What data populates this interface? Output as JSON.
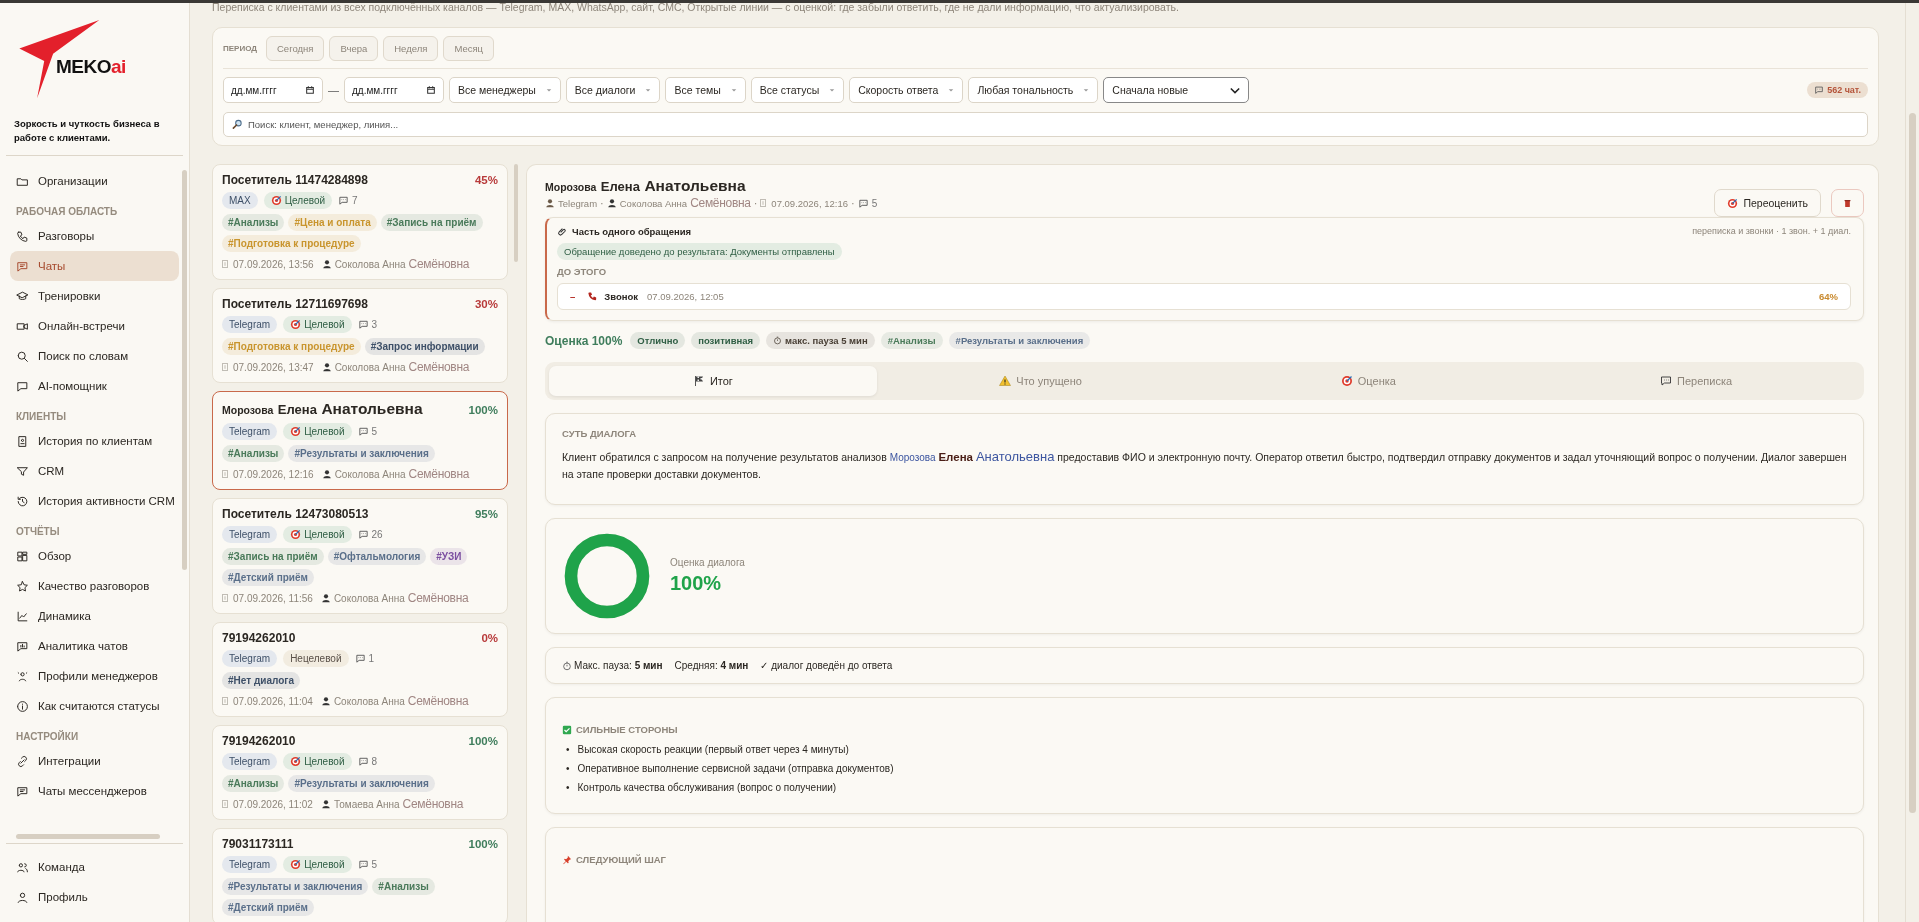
{
  "page": {
    "subtitle": "Переписка с клиентами из всех подключённых каналов — Telegram, MAX, WhatsApp, сайт, СМС, Открытые линии — с оценкой: где забыли ответить, где не дали информацию, что актуализировать."
  },
  "sidebar": {
    "logo": {
      "main": "MEKO",
      "accent": "ai"
    },
    "tagline": "Зоркость и чуткость бизнеса в работе с клиентами.",
    "groups": [
      {
        "items": [
          {
            "label": "Организации",
            "kind": "folder",
            "selected": false
          }
        ]
      },
      {
        "title": "РАБОЧАЯ ОБЛАСТЬ",
        "items": [
          {
            "label": "Разговоры",
            "kind": "phone",
            "selected": false
          },
          {
            "label": "Чаты",
            "kind": "chat",
            "selected": true
          },
          {
            "label": "Тренировки",
            "kind": "cap",
            "selected": false
          },
          {
            "label": "Онлайн-встречи",
            "kind": "video",
            "selected": false
          },
          {
            "label": "Поиск по словам",
            "kind": "search",
            "selected": false
          },
          {
            "label": "AI-помощник",
            "kind": "bubble",
            "selected": false
          }
        ]
      },
      {
        "title": "КЛИЕНТЫ",
        "items": [
          {
            "label": "История по клиентам",
            "kind": "card",
            "selected": false
          },
          {
            "label": "CRM",
            "kind": "filter",
            "selected": false
          },
          {
            "label": "История активности CRM",
            "kind": "history",
            "selected": false
          }
        ]
      },
      {
        "title": "ОТЧЁТЫ",
        "items": [
          {
            "label": "Обзор",
            "kind": "grid",
            "selected": false
          },
          {
            "label": "Качество разговоров",
            "kind": "star",
            "selected": false
          },
          {
            "label": "Динамика",
            "kind": "chart",
            "selected": false
          },
          {
            "label": "Аналитика чатов",
            "kind": "stats",
            "selected": false
          },
          {
            "label": "Профили менеджеров",
            "kind": "profile",
            "selected": false
          },
          {
            "label": "Как считаются статусы",
            "kind": "info",
            "selected": false
          }
        ]
      },
      {
        "title": "НАСТРОЙКИ",
        "items": [
          {
            "label": "Интеграции",
            "kind": "link",
            "selected": false
          },
          {
            "label": "Чаты мессенджеров",
            "kind": "chat",
            "selected": false
          }
        ]
      }
    ],
    "footer": [
      {
        "label": "Команда",
        "kind": "team",
        "selected": false
      },
      {
        "label": "Профиль",
        "kind": "user",
        "selected": false
      }
    ]
  },
  "filters": {
    "period_label": "ПЕРИОД",
    "periods": [
      {
        "label": "Сегодня",
        "selected": false
      },
      {
        "label": "Вчера",
        "selected": false
      },
      {
        "label": "Неделя",
        "selected": false
      },
      {
        "label": "Месяц",
        "selected": false
      }
    ],
    "date_from": {
      "placeholder": "дд.мм.гггг"
    },
    "date_separator": "—",
    "date_to": {
      "placeholder": "дд.мм.гггг"
    },
    "dropdowns": [
      "Все менеджеры",
      "Все диалоги",
      "Все темы",
      "Все статусы",
      "Скорость ответа",
      "Любая тональность"
    ],
    "sort": "Сначала новые",
    "count": "562 чат.",
    "search": {
      "placeholder": "Поиск: клиент, менеджер, линия..."
    }
  },
  "chats": [
    {
      "title": "Посетитель 11474284898",
      "score": "45%",
      "color": "#b83a3a",
      "channel": "MAX",
      "target": {
        "label": "Целевой",
        "targeted": true
      },
      "messages": "7",
      "tags": [
        {
          "label": "#Анализы",
          "color": "#4a7a5a"
        },
        {
          "label": "#Цена и оплата",
          "color": "#c9952e"
        },
        {
          "label": "#Запись на приём",
          "color": "#4a7a5a"
        },
        {
          "label": "#Подготовка к процедуре",
          "color": "#c9952e"
        }
      ],
      "date": "07.09.2026, 13:56",
      "manager": [
        "Соколова Анна",
        "Семёновна"
      ],
      "selected": false
    },
    {
      "title": "Посетитель 12711697698",
      "score": "30%",
      "color": "#b83a3a",
      "channel": "Telegram",
      "target": {
        "label": "Целевой",
        "targeted": true
      },
      "messages": "3",
      "tags": [
        {
          "label": "#Подготовка к процедуре",
          "color": "#c9952e"
        },
        {
          "label": "#Запрос информации",
          "color": "#3e5068"
        }
      ],
      "date": "07.09.2026, 13:47",
      "manager": [
        "Соколова Анна",
        "Семёновна"
      ],
      "selected": false
    },
    {
      "name": [
        "Морозова",
        "Елена",
        "Анатольевна"
      ],
      "score": "100%",
      "color": "#3f7d5c",
      "channel": "Telegram",
      "target": {
        "label": "Целевой",
        "targeted": true
      },
      "messages": "5",
      "tags": [
        {
          "label": "#Анализы",
          "color": "#4a7a5a"
        },
        {
          "label": "#Результаты и заключения",
          "color": "#5a6f8a"
        }
      ],
      "date": "07.09.2026, 12:16",
      "manager": [
        "Соколова Анна",
        "Семёновна"
      ],
      "selected": true
    },
    {
      "title": "Посетитель 12473080513",
      "score": "95%",
      "color": "#3f7d5c",
      "channel": "Telegram",
      "target": {
        "label": "Целевой",
        "targeted": true
      },
      "messages": "26",
      "tags": [
        {
          "label": "#Запись на приём",
          "color": "#4a7a5a"
        },
        {
          "label": "#Офтальмология",
          "color": "#5a6f8a"
        },
        {
          "label": "#УЗИ",
          "color": "#7b4fa0"
        },
        {
          "label": "#Детский приём",
          "color": "#5a6f8a"
        }
      ],
      "date": "07.09.2026, 11:56",
      "manager": [
        "Соколова Анна",
        "Семёновна"
      ],
      "selected": false
    },
    {
      "title": "79194262010",
      "score": "0%",
      "color": "#b83a3a",
      "channel": "Telegram",
      "target": {
        "label": "Нецелевой",
        "targeted": false
      },
      "messages": "1",
      "tags": [
        {
          "label": "#Нет диалога",
          "color": "#3e5068"
        }
      ],
      "date": "07.09.2026, 11:04",
      "manager": [
        "Соколова Анна",
        "Семёновна"
      ],
      "selected": false
    },
    {
      "title": "79194262010",
      "score": "100%",
      "color": "#3f7d5c",
      "channel": "Telegram",
      "target": {
        "label": "Целевой",
        "targeted": true
      },
      "messages": "8",
      "tags": [
        {
          "label": "#Анализы",
          "color": "#4a7a5a"
        },
        {
          "label": "#Результаты и заключения",
          "color": "#5a6f8a"
        }
      ],
      "date": "07.09.2026, 11:02",
      "manager": [
        "Томаева Анна",
        "Семёновна"
      ],
      "selected": false
    },
    {
      "title": "79031173111",
      "score": "100%",
      "color": "#3f7d5c",
      "channel": "Telegram",
      "target": {
        "label": "Целевой",
        "targeted": true
      },
      "messages": "5",
      "tags": [
        {
          "label": "#Результаты и заключения",
          "color": "#5a6f8a"
        },
        {
          "label": "#Анализы",
          "color": "#4a7a5a"
        },
        {
          "label": "#Детский приём",
          "color": "#5a6f8a"
        }
      ],
      "selected": false
    }
  ],
  "detail": {
    "name": [
      "Морозова",
      "Елена",
      "Анатольевна"
    ],
    "meta": {
      "separator": "·",
      "channel": "Telegram",
      "manager": [
        "Соколова Анна",
        "Семёновна"
      ],
      "date": "07.09.2026, 12:16",
      "messages": "5"
    },
    "rescore": "Переоценить",
    "linked": {
      "title": "Часть одного обращения",
      "summary": "переписка и звонки · 1 звон. + 1 диал.",
      "result": "Обращение доведено до результата: Документы отправлены",
      "before_label": "ДО ЭТОГО",
      "events": [
        {
          "toggle": "–",
          "kind": "call",
          "label": "Звонок",
          "date": "07.09.2026, 12:05",
          "score": "64%"
        }
      ]
    },
    "score": {
      "label": "Оценка 100%",
      "tags": [
        {
          "label": "Отлично",
          "kind": "plain",
          "color": "#2f5e44"
        },
        {
          "label": "позитивная",
          "kind": "plain",
          "color": "#2f5e44"
        },
        {
          "label": "макс. пауза 5 мин",
          "kind": "timer",
          "color": "#4a4036"
        },
        {
          "label": "#Анализы",
          "kind": "plain",
          "color": "#4a7a5a"
        },
        {
          "label": "#Результаты и заключения",
          "kind": "plain",
          "color": "#5a6f8a"
        }
      ]
    },
    "tabs": [
      {
        "label": "Итог",
        "kind": "flag",
        "selected": true
      },
      {
        "label": "Что упущено",
        "kind": "warning",
        "selected": false
      },
      {
        "label": "Оценка",
        "kind": "target",
        "selected": false
      },
      {
        "label": "Переписка",
        "kind": "chat",
        "selected": false
      }
    ],
    "summary": {
      "title": "СУТЬ ДИАЛОГА",
      "before": "Клиент обратился с запросом на получение результатов анализов",
      "name": [
        "Морозова",
        "Елена",
        "Анатольевна"
      ],
      "after": "предоставив ФИО и электронную почту. Оператор ответил быстро, подтвердил отправку документов и задал уточняющий вопрос о получении. Диалог завершен на этапе проверки доставки документов."
    },
    "gauge": {
      "label": "Оценка диалога",
      "value": "100%",
      "level": 1
    },
    "timing": {
      "max": "Макс. пауза: **5 мин**",
      "avg": "Средняя: **4 мин**",
      "outcome": "✓ диалог доведён до ответа"
    },
    "strengths": {
      "title": "СИЛЬНЫЕ СТОРОНЫ",
      "bullet": "•",
      "items": [
        "Высокая скорость реакции (первый ответ через 4 минуты)",
        "Оперативное выполнение сервисной задачи (отправка документов)",
        "Контроль качества обслуживания (вопрос о получении)"
      ]
    },
    "next_step": {
      "title": "СЛЕДУЮЩИЙ ШАГ"
    }
  }
}
